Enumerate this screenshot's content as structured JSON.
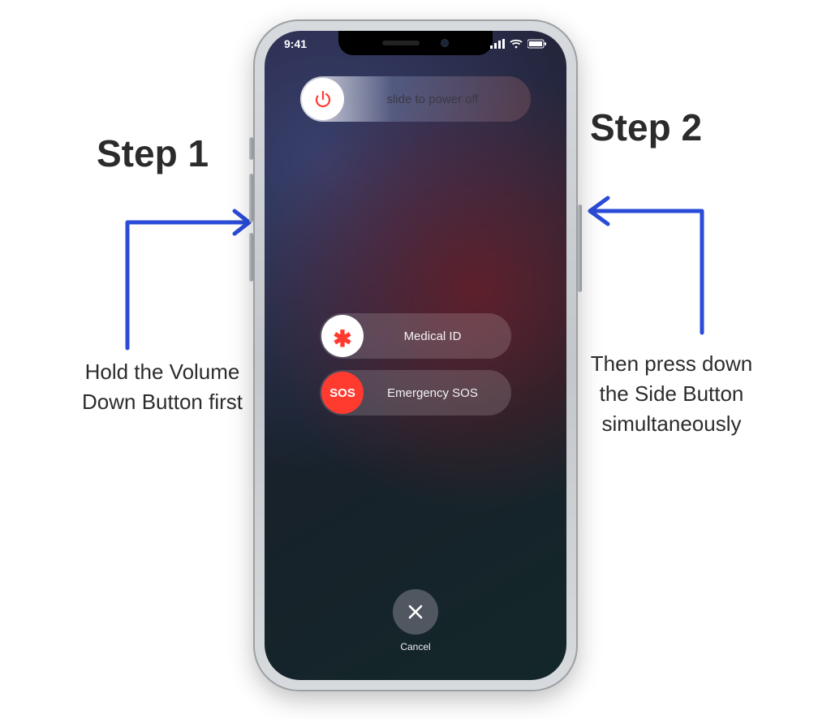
{
  "steps": {
    "step1": {
      "title": "Step 1",
      "desc": "Hold the Volume Down Button first"
    },
    "step2": {
      "title": "Step 2",
      "desc": "Then press down the Side Button simultaneously"
    }
  },
  "statusbar": {
    "time": "9:41"
  },
  "sliders": {
    "power": {
      "label": "slide to power off"
    },
    "medical": {
      "label": "Medical ID"
    },
    "sos": {
      "label": "Emergency SOS",
      "knob_text": "SOS"
    }
  },
  "cancel": {
    "label": "Cancel"
  },
  "icons": {
    "power": "power-icon",
    "asterisk": "asterisk-icon",
    "close": "close-icon",
    "signal": "signal-icon",
    "wifi": "wifi-icon",
    "battery": "battery-icon"
  }
}
